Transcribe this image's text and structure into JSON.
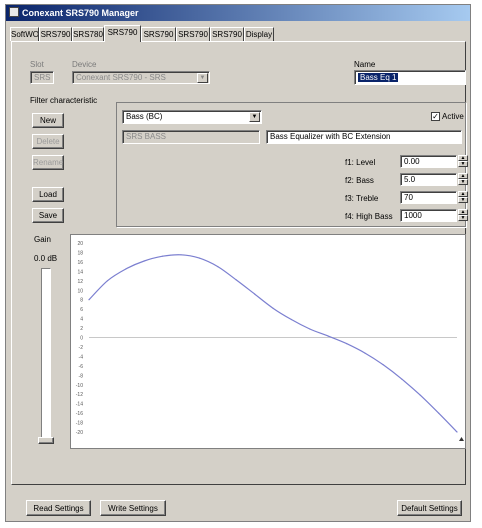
{
  "window": {
    "title": "Conexant SRS790 Manager"
  },
  "tabs": [
    {
      "label": "SoftWOW"
    },
    {
      "label": "SRS790"
    },
    {
      "label": "SRS780"
    },
    {
      "label": "SRS790"
    },
    {
      "label": "SRS790"
    },
    {
      "label": "SRS790"
    },
    {
      "label": "SRS790"
    },
    {
      "label": "Display"
    }
  ],
  "top": {
    "slot_label": "Slot",
    "slot_value": "SRS",
    "device_label": "Device",
    "device_value": "Conexant SRS790 - SRS",
    "name_label": "Name",
    "name_value": "Bass Eq 1"
  },
  "filter": {
    "group_label": "Filter characteristic",
    "buttons": [
      "New",
      "Delete",
      "Rename",
      "Load",
      "Save"
    ],
    "type_value": "Bass (BC)",
    "active_label": "Active",
    "active_checked": true,
    "code_value": "SRS BASS",
    "description_value": "Bass Equalizer with BC Extension",
    "params": [
      {
        "label": "f1: Level",
        "value": "0.00"
      },
      {
        "label": "f2: Bass",
        "value": "5.0"
      },
      {
        "label": "f3: Treble",
        "value": "70"
      },
      {
        "label": "f4: High Bass",
        "value": "1000"
      }
    ]
  },
  "gain": {
    "label": "Gain",
    "value": "0.0 dB",
    "level": 0.5
  },
  "chart_data": {
    "type": "line",
    "title": "",
    "xlabel": "",
    "ylabel": "",
    "x": [
      0,
      5,
      10,
      15,
      20,
      25,
      30,
      35,
      40,
      45,
      50,
      55,
      60,
      65,
      70,
      75,
      80,
      85,
      90,
      95,
      100
    ],
    "series": [
      {
        "values": [
          8,
          12,
          14.5,
          16.2,
          17.2,
          17.5,
          16.8,
          15,
          12.2,
          9.2,
          6.2,
          3.8,
          1.8,
          0.3,
          -1.3,
          -3.3,
          -5.8,
          -8.8,
          -12.2,
          -16,
          -20
        ]
      }
    ],
    "yticks": [
      "20",
      "18",
      "16",
      "14",
      "12",
      "10",
      "8",
      "6",
      "4",
      "2",
      "0",
      "-2",
      "-4",
      "-6",
      "-8",
      "-10",
      "-12",
      "-14",
      "-16",
      "-18",
      "-20"
    ],
    "ylim": [
      -20,
      20
    ],
    "reference_line": 0,
    "grid": false,
    "line_color": "#7b7fd0"
  },
  "bottom": {
    "read_label": "Read Settings",
    "write_label": "Write Settings",
    "default_label": "Default Settings"
  },
  "colors": {
    "face": "#d4d0c8",
    "selection": "#0a246a",
    "titlebar": "#0a246a"
  }
}
